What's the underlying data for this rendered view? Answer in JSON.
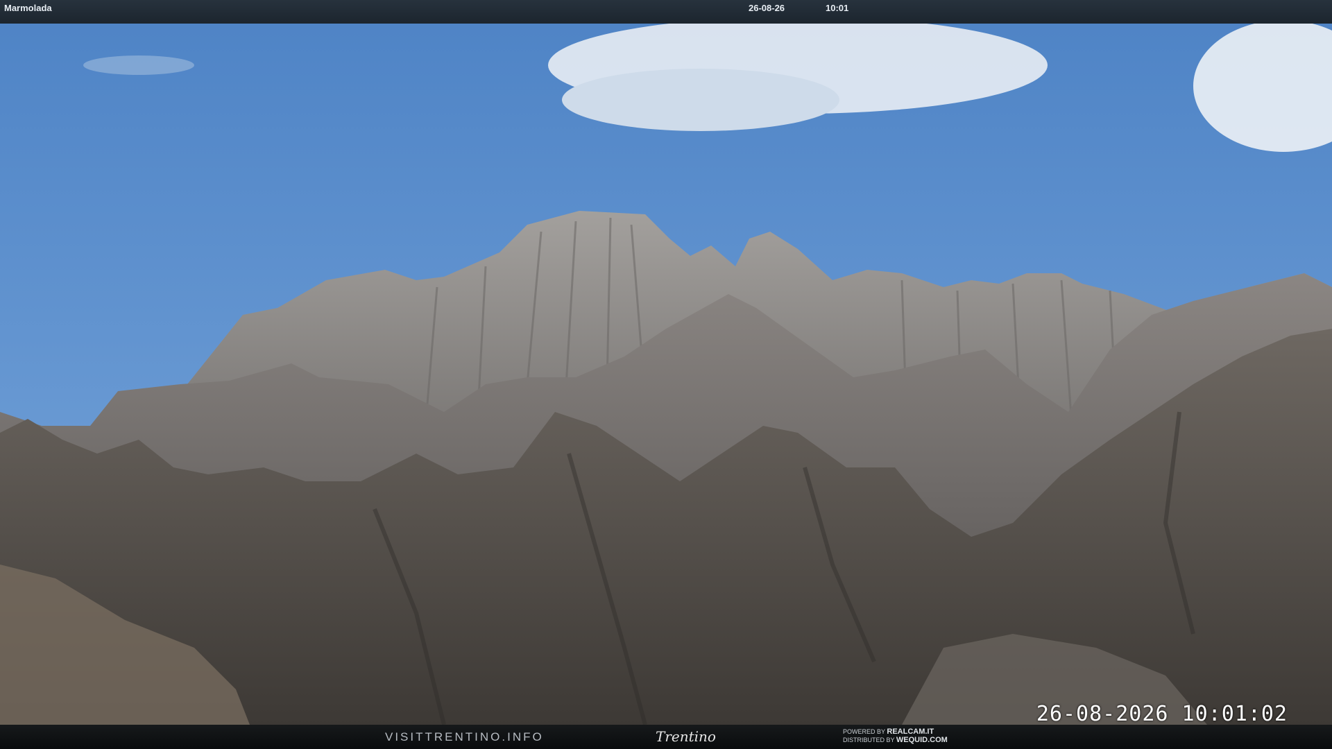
{
  "header": {
    "location": "Marmolada",
    "date": "26-08-26",
    "time": "10:01"
  },
  "overlay": {
    "timestamp": "26-08-2026 10:01:02"
  },
  "footer": {
    "left_brand": "VISITTRENTINO.INFO",
    "logo": "Trentino",
    "powered_prefix": "POWERED BY",
    "powered_name": "REALCAM.IT",
    "distributed_prefix": "DISTRIBUTED BY",
    "distributed_name": "WEQUID.COM"
  },
  "colors": {
    "sky_top": "#5487c8",
    "sky_bottom": "#6f9fd6",
    "rock_light": "#9a9896",
    "rock_dark": "#4a4a4c"
  }
}
